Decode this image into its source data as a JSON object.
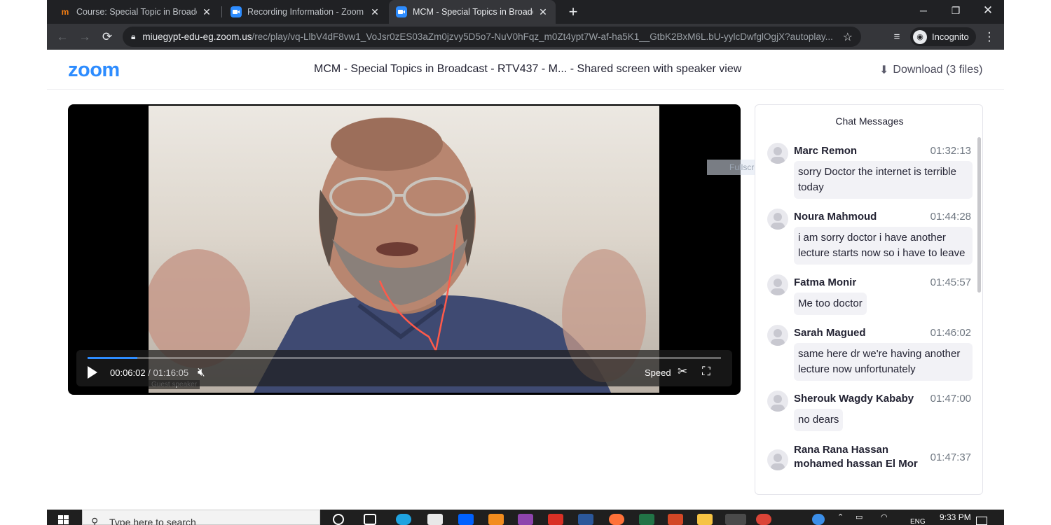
{
  "browser": {
    "tabs": [
      {
        "title": "Course: Special Topic in Broadcas",
        "favicon": "moodle-icon",
        "active": false
      },
      {
        "title": "Recording Information - Zoom",
        "favicon": "zoom-icon",
        "active": false
      },
      {
        "title": "MCM - Special Topics in Broadca",
        "favicon": "zoom-icon",
        "active": true
      }
    ],
    "url_host": "miuegypt-edu-eg.zoom.us",
    "url_path": "/rec/play/vq-LlbV4dF8vw1_VoJsr0zES03aZm0jzvy5D5o7-NuV0hFqz_m0Zt4ypt7W-af-ha5K1__GtbK2BxM6L.bU-yylcDwfglOgjX?autoplay...",
    "incognito_label": "Incognito"
  },
  "header": {
    "logo": "zoom",
    "title": "MCM - Special Topics in Broadcast - RTV437 - M... - Shared screen with speaker view",
    "download_label": "Download (3 files)"
  },
  "player": {
    "current_time": "00:06:02",
    "separator": "/",
    "duration": "01:16:05",
    "speed_label": "Speed",
    "progress_fraction": 0.079,
    "speaker_tag": "Guest speaker"
  },
  "chat": {
    "title": "Chat Messages",
    "overlay_text": "Fullscreen Snip",
    "messages": [
      {
        "name": "Marc Remon",
        "time": "01:32:13",
        "text": "sorry Doctor the internet is terrible today"
      },
      {
        "name": "Noura Mahmoud",
        "time": "01:44:28",
        "text": "i am sorry doctor i have another lecture starts now so i have to leave"
      },
      {
        "name": "Fatma Monir",
        "time": "01:45:57",
        "text": "Me too doctor"
      },
      {
        "name": "Sarah Magued",
        "time": "01:46:02",
        "text": "same here dr we're having another lecture now unfortunately"
      },
      {
        "name": "Sherouk Wagdy Kababy",
        "time": "01:47:00",
        "text": "no dears"
      },
      {
        "name": "Rana Rana Hassan mohamed hassan El Mor",
        "time": "01:47:37",
        "text": ""
      }
    ]
  },
  "taskbar": {
    "search_placeholder": "Type here to search",
    "time": "9:33 PM",
    "lang": "ENG"
  },
  "colors": {
    "zoom_blue": "#2d8cff",
    "chrome_dark": "#202124",
    "chrome_toolbar": "#35363a"
  }
}
